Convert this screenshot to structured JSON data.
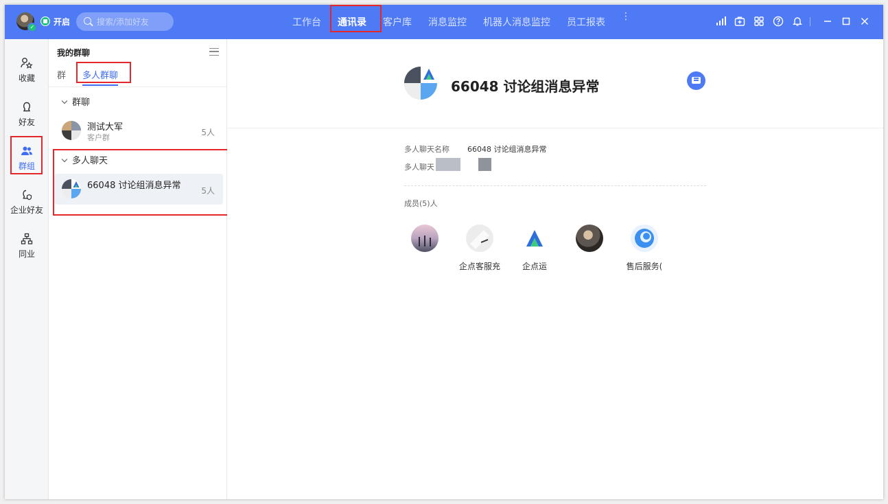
{
  "topbar": {
    "status_label": "开启",
    "search_placeholder": "搜索/添加好友",
    "nav": [
      {
        "label": "工作台"
      },
      {
        "label": "通讯录"
      },
      {
        "label": "客户库"
      },
      {
        "label": "消息监控"
      },
      {
        "label": "机器人消息监控"
      },
      {
        "label": "员工报表"
      }
    ],
    "more_label": "⋮",
    "active_nav": "通讯录"
  },
  "rail": {
    "items": [
      {
        "label": "收藏",
        "icon": "favorites-icon"
      },
      {
        "label": "好友",
        "icon": "friends-icon"
      },
      {
        "label": "群组",
        "icon": "groups-icon"
      },
      {
        "label": "企业好友",
        "icon": "enterprise-friends-icon"
      },
      {
        "label": "同业",
        "icon": "peers-icon"
      }
    ],
    "active": "群组"
  },
  "panel": {
    "title": "我的群聊",
    "tabs": [
      {
        "label": "群"
      },
      {
        "label": "多人群聊"
      }
    ],
    "groups": [
      {
        "header": "群聊",
        "items": [
          {
            "name": "测试大军",
            "sub": "客户群",
            "count": "5人"
          }
        ]
      },
      {
        "header": "多人聊天",
        "items": [
          {
            "name": "66048 讨论组消息异常",
            "count": "5人"
          }
        ]
      }
    ]
  },
  "detail": {
    "title": "66048 讨论组消息异常",
    "fields": [
      {
        "label": "多人聊天名称",
        "value": "66048 讨论组消息异常"
      },
      {
        "label": "多人聊天",
        "value": ""
      }
    ],
    "members_label": "成员(5)人",
    "members": [
      {
        "name": ""
      },
      {
        "name": "企点客服充"
      },
      {
        "name": "企点运"
      },
      {
        "name": ""
      },
      {
        "name": "售后服务("
      }
    ]
  },
  "colors": {
    "brand": "#4f7af5",
    "active_text": "#3e6cf5",
    "highlight_box": "#e5262a"
  }
}
